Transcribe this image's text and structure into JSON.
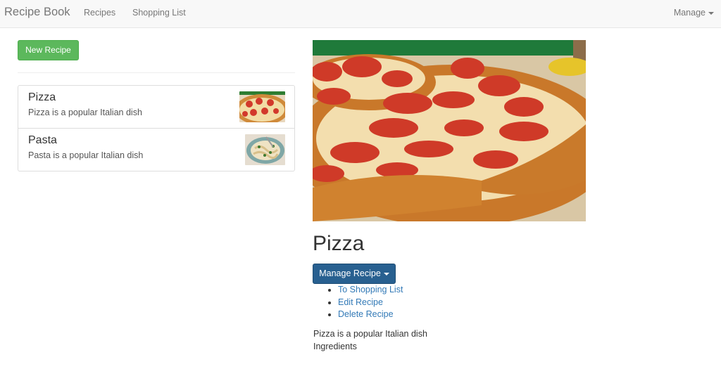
{
  "navbar": {
    "brand": "Recipe Book",
    "links": [
      "Recipes",
      "Shopping List"
    ],
    "manage": "Manage"
  },
  "sidebar": {
    "new_recipe_label": "New Recipe",
    "recipes": [
      {
        "name": "Pizza",
        "description": "Pizza is a popular Italian dish",
        "image": "pizza-thumbnail"
      },
      {
        "name": "Pasta",
        "description": "Pasta is a popular Italian dish",
        "image": "pasta-thumbnail"
      }
    ]
  },
  "detail": {
    "image": "pepperoni-pizza-photo",
    "title": "Pizza",
    "manage_label": "Manage Recipe",
    "menu": [
      "To Shopping List",
      "Edit Recipe",
      "Delete Recipe"
    ],
    "description": "Pizza is a popular Italian dish",
    "ingredients_label": "Ingredients"
  },
  "colors": {
    "success": "#5cb85c",
    "primary": "#286090",
    "link": "#337ab7",
    "navbar_bg": "#f8f8f8"
  }
}
